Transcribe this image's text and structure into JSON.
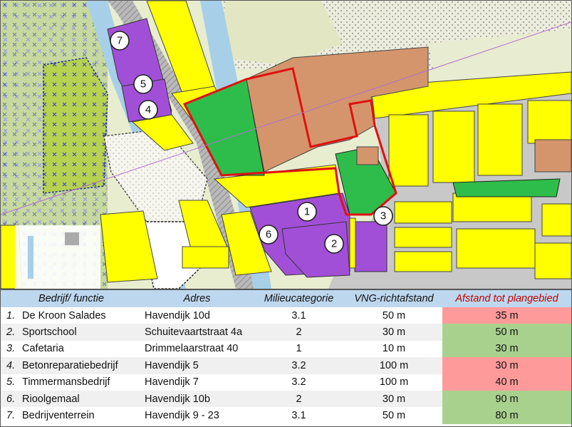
{
  "map": {
    "markers": [
      {
        "label": "1"
      },
      {
        "label": "2"
      },
      {
        "label": "3"
      },
      {
        "label": "4"
      },
      {
        "label": "5"
      },
      {
        "label": "6"
      },
      {
        "label": "7"
      }
    ],
    "colors": {
      "bedrijf": "#a24fd8",
      "wonen": "#ffff00",
      "groen": "#2ebd4a",
      "plangebied_outline": "#e01010",
      "centrum": "#d4956c",
      "water": "#a7cfe8",
      "verkeer": "#c8c8c8",
      "agrarisch": "#b7d24f"
    }
  },
  "table": {
    "headers": [
      "Bedrijf/ functie",
      "Adres",
      "Milieucategorie",
      "VNG-richtafstand",
      "Afstand tot plangebied"
    ],
    "rows": [
      {
        "num": "1.",
        "name": "De Kroon Salades",
        "address": "Havendijk 10d",
        "category": "3.1",
        "vng": "50 m",
        "distance": "35 m",
        "status": "bad"
      },
      {
        "num": "2.",
        "name": "Sportschool",
        "address": "Schuitevaartstraat 4a",
        "category": "2",
        "vng": "30 m",
        "distance": "50 m",
        "status": "ok"
      },
      {
        "num": "3.",
        "name": "Cafetaria",
        "address": "Drimmelaarstraat 40",
        "category": "1",
        "vng": "10 m",
        "distance": "30 m",
        "status": "ok"
      },
      {
        "num": "4.",
        "name": "Betonreparatiebedrijf",
        "address": "Havendijk 5",
        "category": "3.2",
        "vng": "100 m",
        "distance": "30 m",
        "status": "bad"
      },
      {
        "num": "5.",
        "name": "Timmermansbedrijf",
        "address": "Havendijk 7",
        "category": "3.2",
        "vng": "100 m",
        "distance": "40 m",
        "status": "bad"
      },
      {
        "num": "6.",
        "name": "Rioolgemaal",
        "address": "Havendijk 10b",
        "category": "2",
        "vng": "30 m",
        "distance": "90 m",
        "status": "ok"
      },
      {
        "num": "7.",
        "name": "Bedrijventerrein",
        "address": "Havendijk 9 - 23",
        "category": "3.1",
        "vng": "50 m",
        "distance": "80 m",
        "status": "ok"
      }
    ]
  }
}
